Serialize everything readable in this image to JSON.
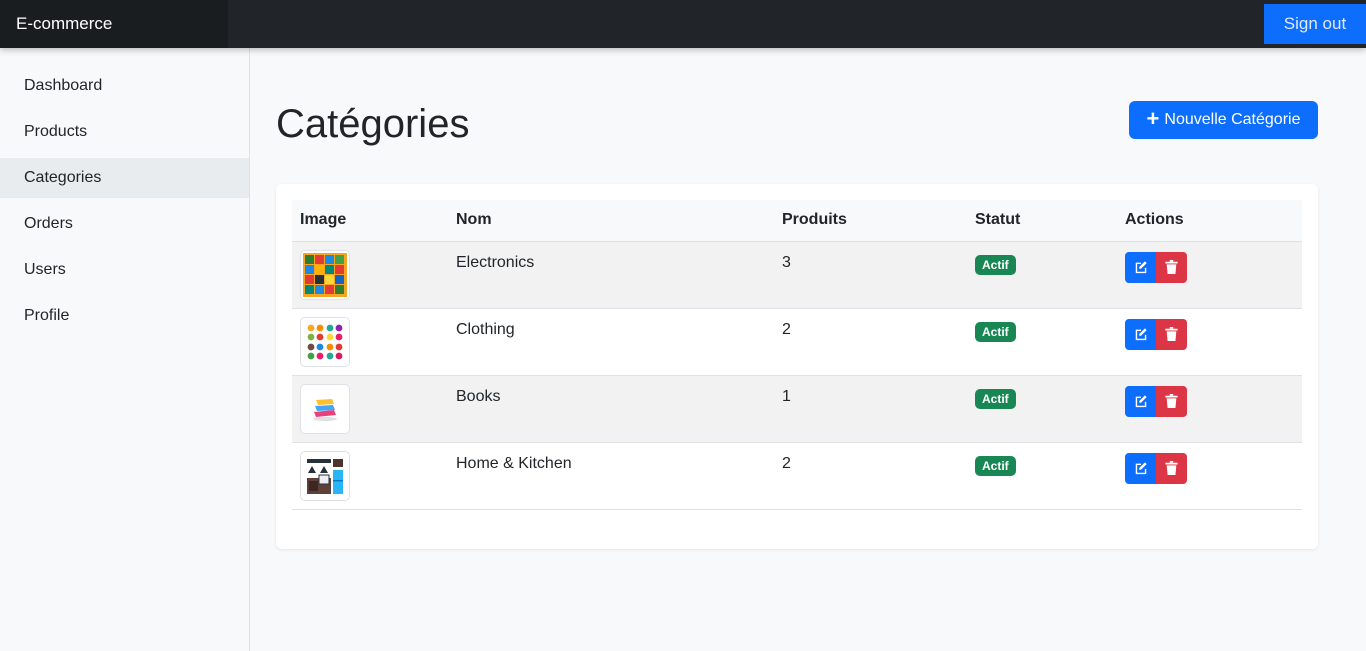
{
  "app": {
    "brand": "E-commerce",
    "signout_label": "Sign out"
  },
  "sidebar": {
    "items": [
      {
        "label": "Dashboard"
      },
      {
        "label": "Products"
      },
      {
        "label": "Categories"
      },
      {
        "label": "Orders"
      },
      {
        "label": "Users"
      },
      {
        "label": "Profile"
      }
    ],
    "active": "Categories"
  },
  "page": {
    "title": "Catégories",
    "new_button": "Nouvelle Catégorie"
  },
  "table": {
    "headers": {
      "image": "Image",
      "nom": "Nom",
      "produits": "Produits",
      "statut": "Statut",
      "actions": "Actions"
    },
    "rows": [
      {
        "nom": "Electronics",
        "produits": "3",
        "statut": "Actif",
        "icon": "electronics-icon"
      },
      {
        "nom": "Clothing",
        "produits": "2",
        "statut": "Actif",
        "icon": "clothing-icon"
      },
      {
        "nom": "Books",
        "produits": "1",
        "statut": "Actif",
        "icon": "books-icon"
      },
      {
        "nom": "Home & Kitchen",
        "produits": "2",
        "statut": "Actif",
        "icon": "kitchen-icon"
      }
    ]
  },
  "colors": {
    "primary": "#0d6efd",
    "danger": "#dc3545",
    "success": "#198754",
    "navbar": "#212529"
  }
}
